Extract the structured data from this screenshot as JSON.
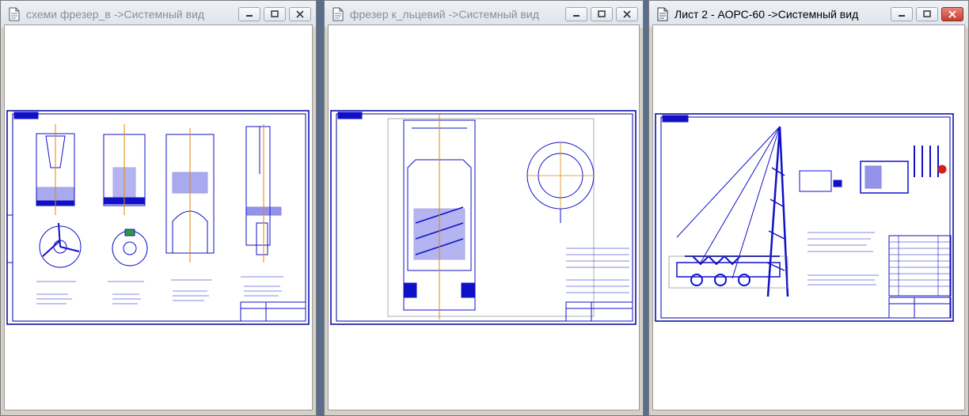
{
  "windows": [
    {
      "title": "схеми фрезер_в ->Системный вид",
      "active": false
    },
    {
      "title": "фрезер к_льцевий ->Системный вид",
      "active": false
    },
    {
      "title": "Лист 2 - АОРС-60 ->Системный вид",
      "active": true
    }
  ],
  "colors": {
    "drawing": "#1010c8",
    "frame": "#0000a0",
    "axis": "#e08a00",
    "close_active": "#c4402f"
  },
  "icons": [
    "document-icon",
    "minimize-icon",
    "maximize-icon",
    "close-icon"
  ]
}
